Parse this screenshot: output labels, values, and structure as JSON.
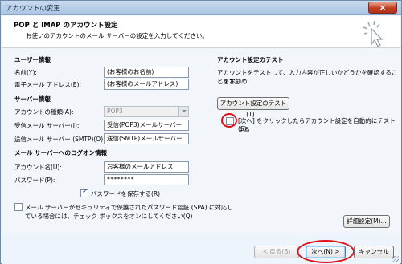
{
  "window": {
    "title": "アカウントの変更"
  },
  "header": {
    "title": "POP と IMAP のアカウント設定",
    "subtitle": "お使いのアカウントのメール サーバーの設定を入力してください。"
  },
  "user_info": {
    "section": "ユーザー情報",
    "name_label": "名前(Y):",
    "name_value": "(お客様のお名前)",
    "email_label": "電子メール アドレス(E):",
    "email_value": "(お客様のメールアドレス)"
  },
  "server_info": {
    "section": "サーバー情報",
    "type_label": "アカウントの種類(A):",
    "type_value": "POP3",
    "incoming_label": "受信メール サーバー(I):",
    "incoming_value": "受信(POP3)メールサーバー",
    "outgoing_label": "送信メール サーバー (SMTP)(O):",
    "outgoing_value": "送信(SMTP)メールサーバー"
  },
  "logon_info": {
    "section": "メール サーバーへのログオン情報",
    "account_label": "アカウント名(U):",
    "account_value": "お客様のメールアドレス",
    "password_label": "パスワード(P):",
    "password_value": "********",
    "save_password_label": "パスワードを保存する(R)",
    "save_password_checked": true,
    "spa_line1": "メール サーバーがセキュリティで保護されたパスワード認証 (SPA) に対応し",
    "spa_line2": "ている場合には、チェック ボックスをオンにしてください(Q)",
    "spa_checked": false
  },
  "test": {
    "section": "アカウント設定のテスト",
    "desc_line1": "アカウントをテストして、入力内容が正しいかどうかを確認することをお勧め",
    "desc_line2": "します。",
    "button_label": "アカウント設定のテスト(T)...",
    "auto_test_line1": "[次へ] をクリックしたらアカウント設定を自動的にテストする",
    "auto_test_line2": "(S)",
    "auto_test_checked": false
  },
  "details_button": "詳細設定(M)...",
  "footer": {
    "back_label": "< 戻る(B)",
    "next_label": "次へ(N) >",
    "cancel_label": "キャンセル"
  },
  "colors": {
    "highlight_ring": "#e0101a",
    "accent": "#3c7fb1"
  }
}
